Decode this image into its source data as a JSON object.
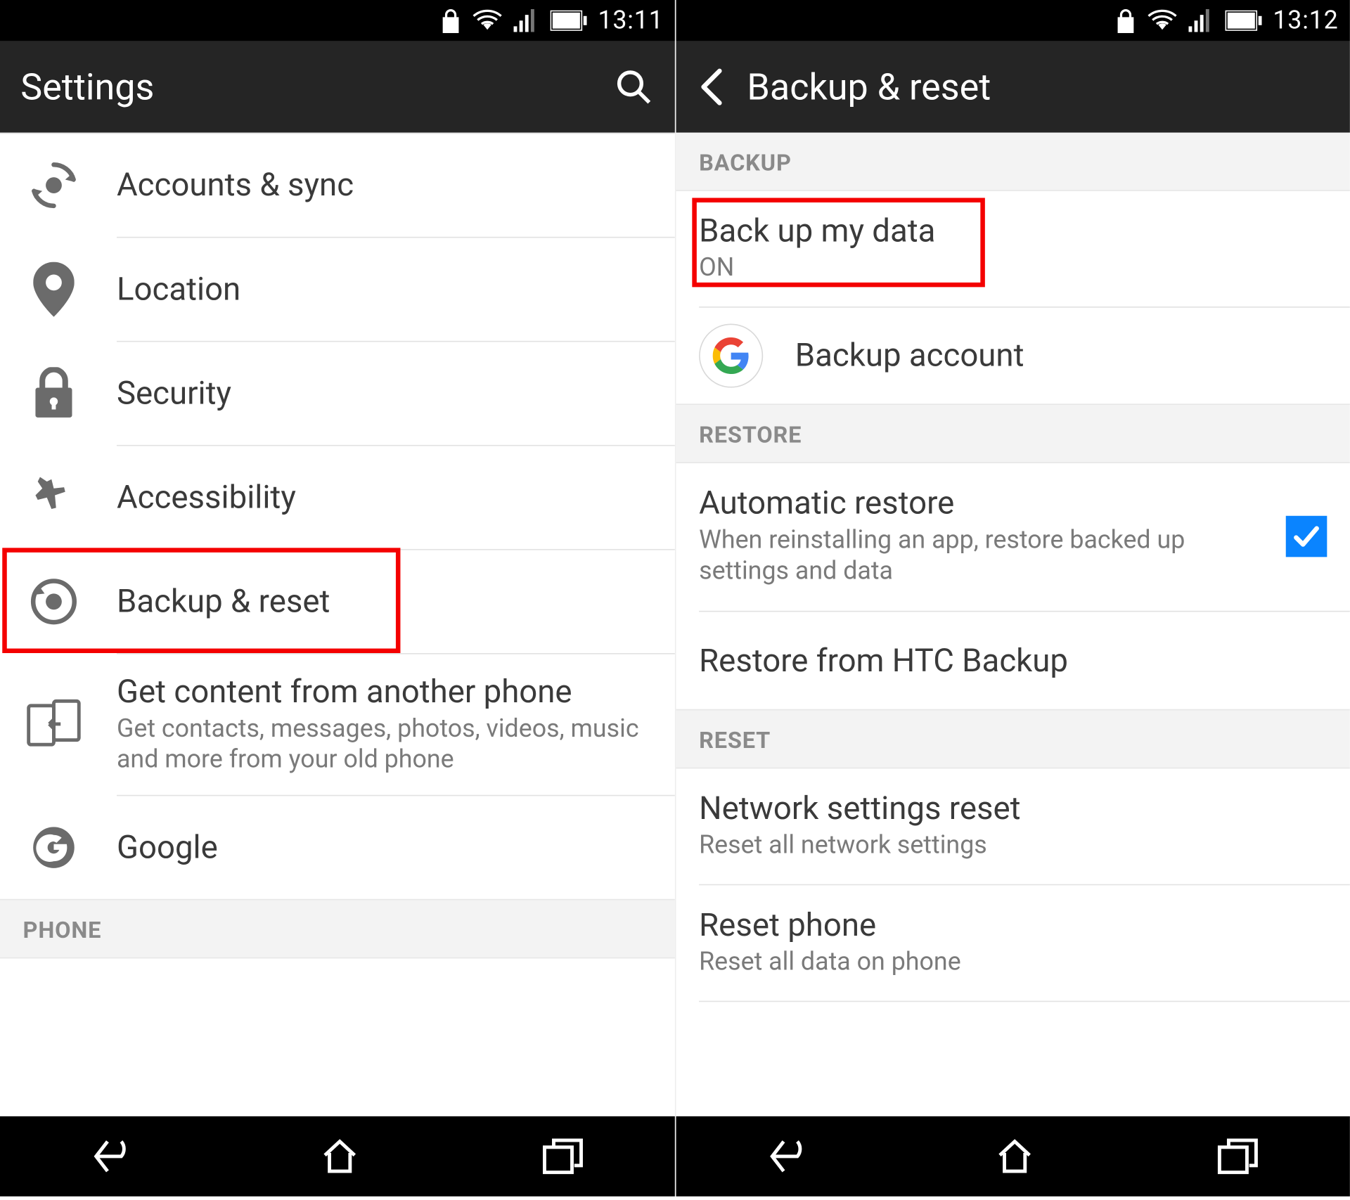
{
  "left": {
    "statusbar": {
      "time": "13:11"
    },
    "title": "Settings",
    "items": [
      {
        "label": "Accounts & sync"
      },
      {
        "label": "Location"
      },
      {
        "label": "Security"
      },
      {
        "label": "Accessibility"
      },
      {
        "label": "Backup & reset"
      },
      {
        "title": "Get content from another phone",
        "sub": "Get contacts, messages, photos, videos, music and more from your old phone"
      },
      {
        "label": "Google"
      }
    ],
    "section_phone": "PHONE"
  },
  "right": {
    "statusbar": {
      "time": "13:12"
    },
    "title": "Backup & reset",
    "sections": {
      "backup": "BACKUP",
      "restore": "RESTORE",
      "reset": "RESET"
    },
    "items": {
      "backup_data": {
        "title": "Back up my data",
        "sub": "ON"
      },
      "backup_account": {
        "title": "Backup account"
      },
      "auto_restore": {
        "title": "Automatic restore",
        "sub": "When reinstalling an app, restore backed up settings and data",
        "checked": true
      },
      "restore_htc": {
        "title": "Restore from HTC Backup"
      },
      "network_reset": {
        "title": "Network settings reset",
        "sub": "Reset all network settings"
      },
      "reset_phone": {
        "title": "Reset phone",
        "sub": "Reset all data on phone"
      }
    }
  }
}
